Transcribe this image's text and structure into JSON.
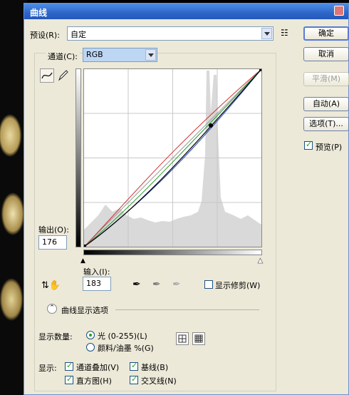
{
  "window": {
    "title": "曲线"
  },
  "preset": {
    "label": "预设(R):",
    "value": "自定"
  },
  "channel": {
    "label": "通道(C):",
    "value": "RGB"
  },
  "buttons": {
    "ok": "确定",
    "cancel": "取消",
    "smooth": "平滑(M)",
    "auto": "自动(A)",
    "options": "选项(T)..."
  },
  "preview": {
    "label": "预览(P)",
    "checked": true
  },
  "output": {
    "label": "输出(O):",
    "value": "176"
  },
  "input": {
    "label": "输入(I):",
    "value": "183"
  },
  "show_clipping": {
    "label": "显示修剪(W)",
    "checked": false
  },
  "curve_display": {
    "section_label": "曲线显示选项",
    "show_amount_label": "显示数量:",
    "light_option": "光 (0-255)(L)",
    "pigment_option": "颜料/油墨 %(G)",
    "show_label": "显示:",
    "channel_overlays": "通道叠加(V)",
    "baseline": "基线(B)",
    "histogram": "直方图(H)",
    "intersection": "交叉线(N)"
  }
}
